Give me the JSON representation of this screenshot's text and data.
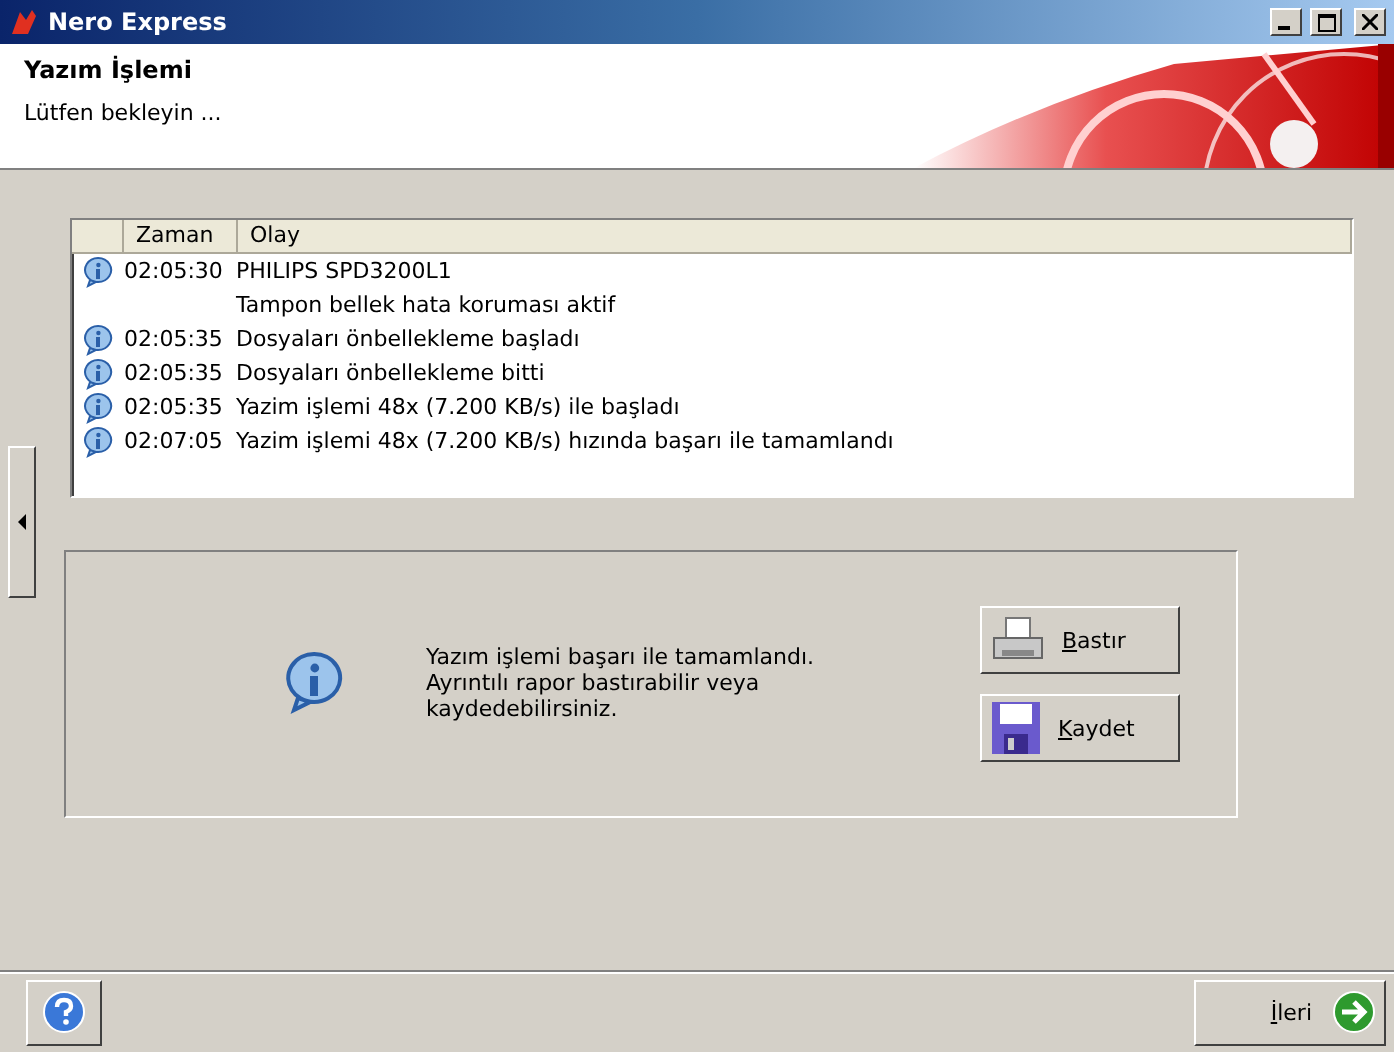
{
  "window": {
    "title": "Nero Express"
  },
  "header": {
    "title": "Yazım İşlemi",
    "subtitle": "Lütfen bekleyin ..."
  },
  "log": {
    "columns": [
      "Zaman",
      "Olay"
    ],
    "rows": [
      {
        "info": true,
        "time": "02:05:30",
        "event": "PHILIPS SPD3200L1"
      },
      {
        "info": false,
        "event": "Tampon bellek hata koruması aktif"
      },
      {
        "info": true,
        "time": "02:05:35",
        "event": "Dosyaları önbellekleme başladı"
      },
      {
        "info": true,
        "time": "02:05:35",
        "event": "Dosyaları önbellekleme bitti"
      },
      {
        "info": true,
        "time": "02:05:35",
        "event": "Yazim işlemi 48x (7.200 KB/s) ile başladı"
      },
      {
        "info": true,
        "time": "02:07:05",
        "event": "Yazim işlemi 48x (7.200 KB/s) hızında başarı ile tamamlandı"
      }
    ]
  },
  "message": {
    "text": "Yazım işlemi başarı ile tamamlandı.\nAyrıntılı rapor bastırabilir veya\nkaydedebilirsiniz.",
    "buttons": [
      {
        "kind": "print",
        "label": "Bastır"
      },
      {
        "kind": "save",
        "label": "Kaydet"
      }
    ]
  },
  "footer": {
    "next": "İleri"
  }
}
